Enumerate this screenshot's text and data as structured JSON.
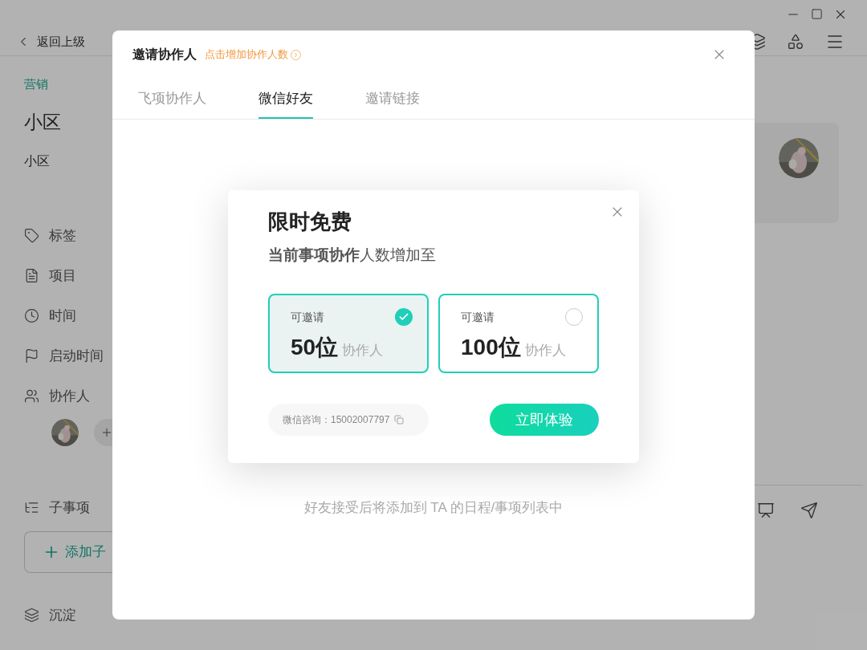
{
  "topbar": {
    "back": "返回上级"
  },
  "sidebar": {
    "category": "营销",
    "title": "小区",
    "description": "小区",
    "fields": [
      {
        "kind": "tag",
        "label": "标签"
      },
      {
        "kind": "project",
        "label": "项目"
      },
      {
        "kind": "time",
        "label": "时间"
      },
      {
        "kind": "flag",
        "label": "启动时间"
      },
      {
        "kind": "people",
        "label": "协作人"
      }
    ],
    "subtasks": {
      "label": "子事项",
      "add_button": "添加子"
    },
    "deposit": {
      "label": "沉淀"
    }
  },
  "modal": {
    "title": "邀请协作人",
    "link": "点击增加协作人数",
    "tabs": [
      {
        "label": "飞项协作人",
        "selected": false
      },
      {
        "label": "微信好友",
        "selected": true
      },
      {
        "label": "邀请链接",
        "selected": false
      }
    ],
    "hint": "好友接受后将添加到 TA 的日程/事项列表中"
  },
  "popup": {
    "title": "限时免费",
    "subtitle": "**当前事项协作**人数增加至",
    "options": [
      {
        "caption": "可邀请",
        "count": "50位",
        "unit": "协作人",
        "selected": true
      },
      {
        "caption": "可邀请",
        "count": "100位",
        "unit": "协作人",
        "selected": false
      }
    ],
    "contact": "微信咨询：15002007797",
    "cta": "立即体验"
  }
}
